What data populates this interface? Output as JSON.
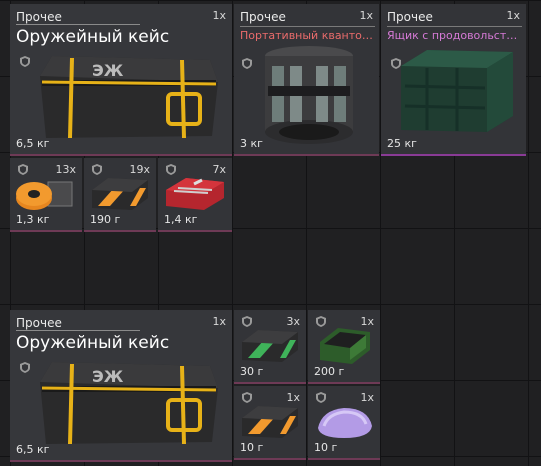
{
  "items": [
    {
      "category": "Прочее",
      "count": "1x",
      "title": "Оружейный кейс",
      "weight": "6,5 кг",
      "icon": "weapon-case-icon"
    },
    {
      "category": "Прочее",
      "count": "1x",
      "subtitle": "Портативный квантовы...",
      "weight": "3 кг",
      "icon": "quantum-device-icon"
    },
    {
      "category": "Прочее",
      "count": "1x",
      "subtitle": "Ящик с продовольствие...",
      "weight": "25 кг",
      "icon": "food-crate-icon"
    },
    {
      "count": "13x",
      "weight": "1,3 кг",
      "icon": "orange-spool-icon"
    },
    {
      "count": "19x",
      "weight": "190 г",
      "icon": "orange-chip-icon"
    },
    {
      "count": "7x",
      "weight": "1,4 кг",
      "icon": "red-toolbox-icon"
    },
    {
      "category": "Прочее",
      "count": "1x",
      "title": "Оружейный кейс",
      "weight": "6,5 кг",
      "icon": "weapon-case-icon"
    },
    {
      "count": "3x",
      "weight": "30 г",
      "icon": "green-chip-icon"
    },
    {
      "count": "1x",
      "weight": "200 г",
      "icon": "green-device-icon"
    },
    {
      "count": "1x",
      "weight": "10 г",
      "icon": "orange-chip-icon"
    },
    {
      "count": "1x",
      "weight": "10 г",
      "icon": "purple-powder-icon"
    }
  ],
  "colors": {
    "red_label": "#e96b6b",
    "pink_label": "#d67ad6",
    "accent_yellow": "#e7b218"
  }
}
